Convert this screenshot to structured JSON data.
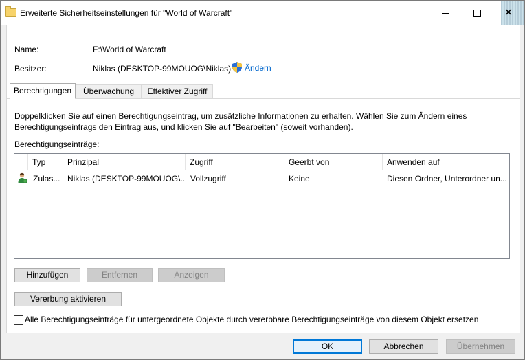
{
  "window": {
    "title": "Erweiterte Sicherheitseinstellungen für \"World of Warcraft\"",
    "min_glyph": "",
    "max_glyph": "",
    "close_glyph": "✕"
  },
  "info": {
    "name_label": "Name:",
    "name_value": "F:\\World of Warcraft",
    "owner_label": "Besitzer:",
    "owner_value": "Niklas (DESKTOP-99MOUOG\\Niklas)",
    "change_link": "Ändern"
  },
  "tabs": [
    {
      "label": "Berechtigungen",
      "active": true
    },
    {
      "label": "Überwachung",
      "active": false
    },
    {
      "label": "Effektiver Zugriff",
      "active": false
    }
  ],
  "description": "Doppelklicken Sie auf einen Berechtigungseintrag, um zusätzliche Informationen zu erhalten. Wählen Sie zum Ändern eines Berechtigungseintrags den Eintrag aus, und klicken Sie auf \"Bearbeiten\" (soweit vorhanden).",
  "entries_label": "Berechtigungseinträge:",
  "columns": [
    "Typ",
    "Prinzipal",
    "Zugriff",
    "Geerbt von",
    "Anwenden auf"
  ],
  "rows": [
    {
      "type": "Zulas...",
      "principal": "Niklas (DESKTOP-99MOUOG\\...",
      "access": "Vollzugriff",
      "inherited": "Keine",
      "applies": "Diesen Ordner, Unterordner un..."
    }
  ],
  "buttons": {
    "add": "Hinzufügen",
    "remove": "Entfernen",
    "view": "Anzeigen",
    "inheritance": "Vererbung aktivieren",
    "ok": "OK",
    "cancel": "Abbrechen",
    "apply": "Übernehmen"
  },
  "replace_checkbox_label": "Alle Berechtigungseinträge für untergeordnete Objekte durch vererbbare Berechtigungseinträge von diesem Objekt ersetzen",
  "colors": {
    "link": "#0066cc",
    "primary_border": "#0078d7"
  }
}
